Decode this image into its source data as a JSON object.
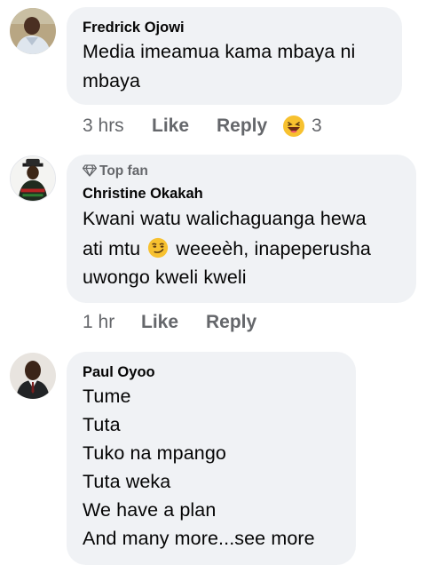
{
  "comments": [
    {
      "author": "Fredrick Ojowi",
      "text_lines": [
        "Media imeamua kama mbaya ni",
        "mbaya"
      ],
      "time": "3 hrs",
      "like_label": "Like",
      "reply_label": "Reply",
      "reaction_icon": "laughing-emoji-icon",
      "reaction_count": "3"
    },
    {
      "badge": "Top fan",
      "badge_icon": "diamond-icon",
      "author": "Christine Okakah",
      "text_lines": [
        "Kwani watu walichaguanga hewa",
        "ati mtu",
        "weeeèh, inapeperusha",
        "uwongo kweli kweli"
      ],
      "inline_emoji_icon": "smirking-emoji-icon",
      "time": "1 hr",
      "like_label": "Like",
      "reply_label": "Reply"
    },
    {
      "author": "Paul Oyoo",
      "text_lines": [
        "Tume",
        "Tuta",
        "Tuko na mpango",
        "Tuta weka",
        "We have a plan",
        "And many more...see more"
      ]
    }
  ],
  "colors": {
    "bubble_bg": "#f0f2f5",
    "text": "#050505",
    "secondary_text": "#65676b"
  }
}
